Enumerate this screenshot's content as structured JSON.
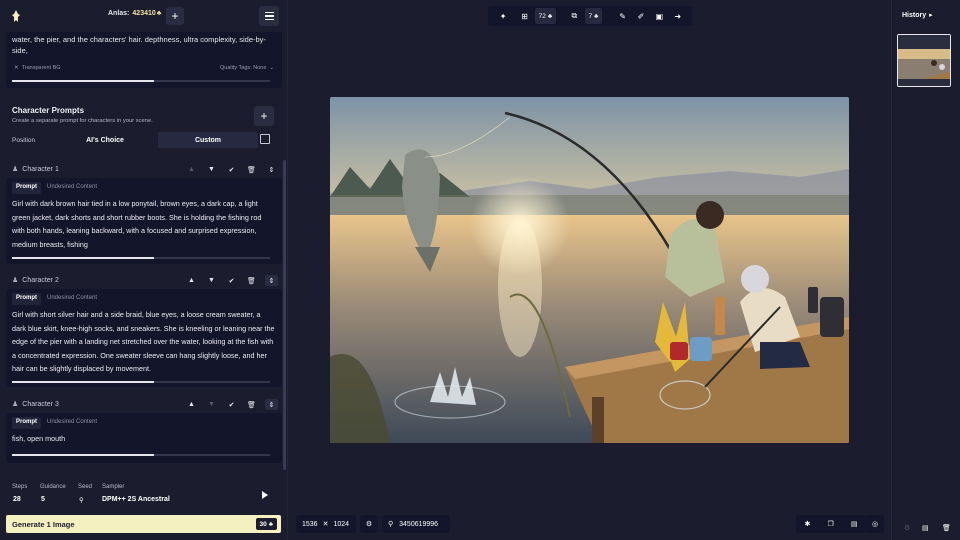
{
  "header": {
    "anlas_label": "Anlas:",
    "anlas_value": "423410",
    "plus": "+"
  },
  "base_prompt": {
    "text_line1": "water, the pier, and the characters' hair. depthness, ultra complexity, side-by-",
    "text_line2": "side,",
    "transparent_bg": "Transparent BG",
    "quality_tags": "Quality Tags: None",
    "progress": 0.55
  },
  "character_prompts": {
    "title": "Character Prompts",
    "subtitle": "Create a separate prompt for characters in your scene.",
    "position_label": "Position",
    "ai_choice": "AI's Choice",
    "custom": "Custom",
    "add": "+"
  },
  "characters": [
    {
      "name": "Character 1",
      "tab_prompt": "Prompt",
      "tab_undesired": "Undesired Content",
      "text": "Girl with dark brown hair tied in a low ponytail, brown eyes, a dark cap, a light green jacket, dark shorts and short rubber boots. She is holding the fishing rod with both hands, leaning backward, with a focused and surprised expression, medium breasts, fishing",
      "progress": 0.55
    },
    {
      "name": "Character 2",
      "tab_prompt": "Prompt",
      "tab_undesired": "Undesired Content",
      "text": "Girl with short silver hair and a side braid, blue eyes, a loose cream sweater, a dark blue skirt, knee-high socks, and sneakers. She is kneeling or leaning near the edge of the pier with a landing net stretched over the water, looking at the fish with a concentrated expression. One sweater sleeve can hang slightly loose, and her hair can be slightly displaced by movement.",
      "progress": 0.55
    },
    {
      "name": "Character 3",
      "tab_prompt": "Prompt",
      "tab_undesired": "Undesired Content",
      "text": "fish, open mouth",
      "progress": 0.55
    }
  ],
  "settings": {
    "steps_label": "Steps",
    "steps_value": "28",
    "guidance_label": "Guidance",
    "guidance_value": "5",
    "seed_label": "Seed",
    "sampler_label": "Sampler",
    "sampler_value": "DPM++ 2S Ancestral"
  },
  "generate": {
    "label": "Generate 1 Image",
    "cost": "30"
  },
  "toolbar": {
    "chip1": "72",
    "chip2": "7"
  },
  "image_bar": {
    "width": "1536",
    "times": "✕",
    "height": "1024",
    "seed": "3450619996"
  },
  "history": {
    "title": "History"
  },
  "colors": {
    "accent": "#f5f0c0",
    "panel": "#13152a",
    "background": "#1b1d2e"
  }
}
